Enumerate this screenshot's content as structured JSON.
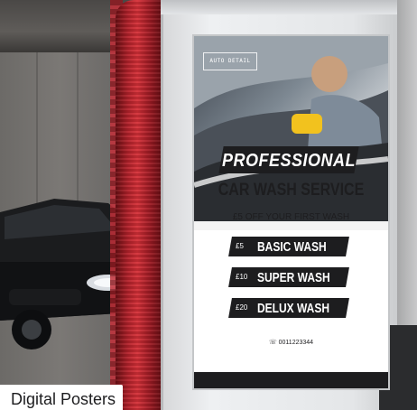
{
  "caption": "Digital Posters",
  "poster": {
    "brand": "AUTO DETAIL",
    "headline": "PROFESSIONAL",
    "subhead": "CAR WASH SERVICE",
    "offer": "£5 OFF YOUR FIRST WASH",
    "services": [
      {
        "price": "£5",
        "label": "BASIC WASH"
      },
      {
        "price": "£10",
        "label": "SUPER WASH"
      },
      {
        "price": "£20",
        "label": "DELUX WASH"
      }
    ],
    "phone": "☏ 0011223344"
  },
  "colors": {
    "poster_dark": "#1d1d1f",
    "brush_red": "#c2303a",
    "case_white": "#eef0f2"
  }
}
